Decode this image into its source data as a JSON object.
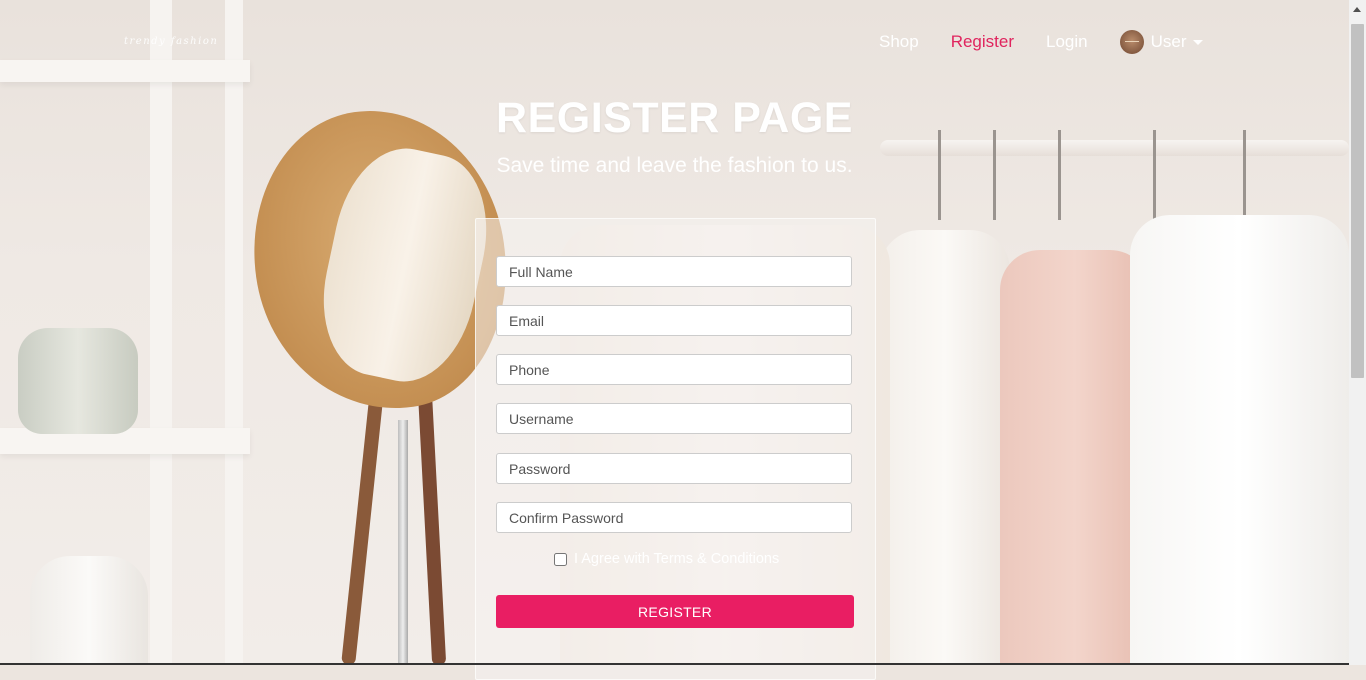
{
  "brand": {
    "logo_text": "trendy fashion"
  },
  "nav": {
    "items": [
      {
        "label": "Shop"
      },
      {
        "label": "Register"
      },
      {
        "label": "Login"
      }
    ],
    "user_label": "User"
  },
  "hero": {
    "title": "REGISTER PAGE",
    "subtitle": "Save time and leave the fashion to us."
  },
  "form": {
    "fields": {
      "full_name": {
        "placeholder": "Full Name",
        "value": ""
      },
      "email": {
        "placeholder": "Email",
        "value": ""
      },
      "phone": {
        "placeholder": "Phone",
        "value": ""
      },
      "username": {
        "placeholder": "Username",
        "value": ""
      },
      "password": {
        "placeholder": "Password",
        "value": ""
      },
      "confirm_password": {
        "placeholder": "Confirm Password",
        "value": ""
      }
    },
    "agree_label": "I Agree with Terms & Conditions",
    "agree_checked": false,
    "submit_label": "REGISTER"
  },
  "colors": {
    "accent": "#e91e63",
    "nav_active": "#e0245e",
    "text_light": "#ffffff"
  }
}
